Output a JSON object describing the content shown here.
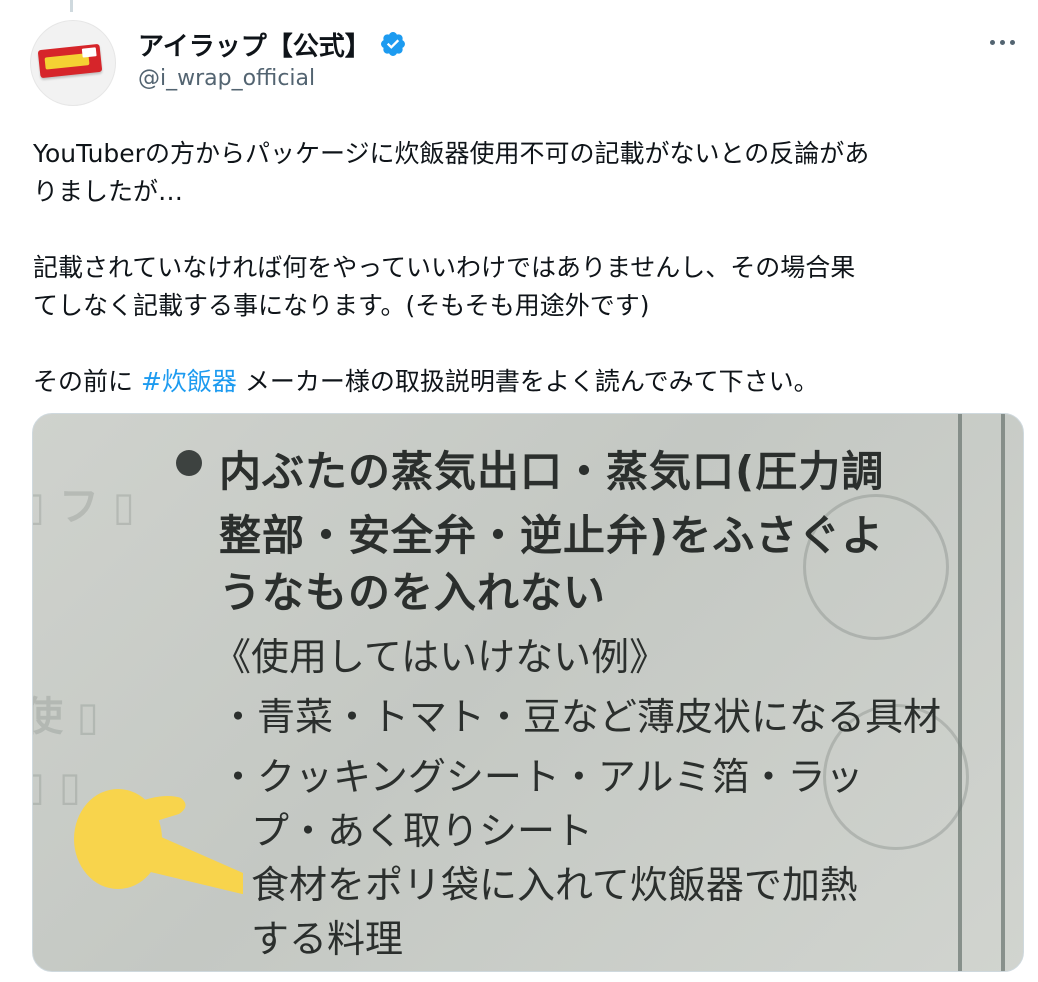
{
  "author": {
    "display_name": "アイラップ【公式】",
    "handle": "@i_wrap_official",
    "verified": true,
    "avatar_icon": "product-box-avatar"
  },
  "colors": {
    "hashtag": "#1d9bf0",
    "verified_badge": "#1d9bf0",
    "secondary_text": "#536471",
    "highlight_hand": "#f8d44c"
  },
  "tweet": {
    "line1": "YouTuberの方からパッケージに炊飯器使用不可の記載がないとの反論があ",
    "line2": "りましたが…",
    "line3": "記載されていなければ何をやっていいわけではありませんし、その場合果",
    "line4": "てしなく記載する事になります。(そもそも用途外です)",
    "line5_prefix": "その前に ",
    "hashtag": "#炊飯器",
    "line5_suffix": " メーカー様の取扱説明書をよく読んでみて下さい。"
  },
  "media": {
    "heading_line1": "内ぶたの蒸気出口・蒸気口(圧力調",
    "heading_line2": "整部・安全弁・逆止弁)をふさぐよ",
    "heading_line3": "うなものを入れない",
    "example_title": "《使用してはいけない例》",
    "item1": "・青菜・トマト・豆など薄皮状になる具材",
    "item2": "・クッキングシート・アルミ箔・ラッ",
    "item2b": "プ・あく取りシート",
    "item3": "食材をポリ袋に入れて炊飯器で加熱",
    "item3b": "する料理"
  },
  "icons": {
    "verified": "verified-badge-icon",
    "more": "more-options-icon",
    "hand": "pointing-hand-icon"
  }
}
